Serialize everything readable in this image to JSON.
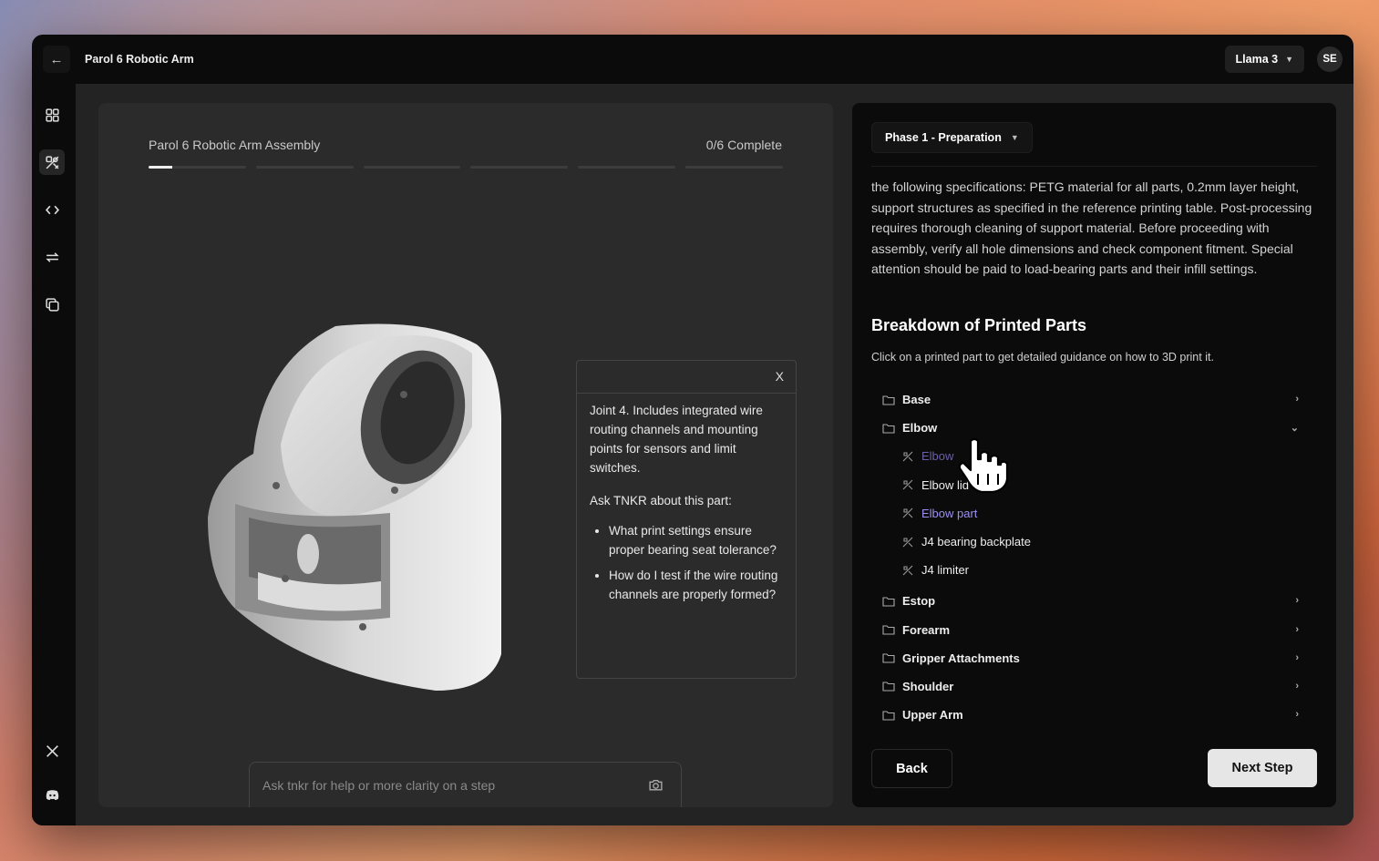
{
  "titlebar": {
    "back_icon": "←",
    "app_title": "Parol 6 Robotic Arm",
    "model": "Llama 3",
    "avatar_initials": "SE"
  },
  "sidebar": {
    "items": [
      {
        "icon": "grid-icon"
      },
      {
        "icon": "tools-icon",
        "active": true
      },
      {
        "icon": "code-icon"
      },
      {
        "icon": "repeat-icon"
      },
      {
        "icon": "copy-icon"
      },
      {
        "icon": "x-logo-icon"
      },
      {
        "icon": "discord-icon"
      }
    ]
  },
  "assembly": {
    "title": "Parol 6 Robotic Arm Assembly",
    "status": "0/6 Complete",
    "progress": {
      "total_steps": 6,
      "completed": 0
    }
  },
  "info_card": {
    "close_label": "X",
    "description": "Joint 4. Includes integrated wire routing channels and mounting points for sensors and limit switches.",
    "ask_heading": "Ask TNKR about this part:",
    "questions": [
      "What print settings ensure proper bearing seat tolerance?",
      "How do I test if the wire routing channels are properly formed?"
    ]
  },
  "chat": {
    "placeholder": "Ask tnkr for help or more clarity on a step"
  },
  "guide": {
    "phase": "Phase 1 - Preparation",
    "spec_text": "the following specifications: PETG material for all parts, 0.2mm layer height, support structures as specified in the reference printing table. Post-processing requires thorough cleaning of support material. Before proceeding with assembly, verify all hole dimensions and check component fitment. Special attention should be paid to load-bearing parts and their infill settings.",
    "breakdown_title": "Breakdown of Printed Parts",
    "breakdown_desc": "Click on a printed part to get detailed guidance on how to 3D print it.",
    "folders": {
      "base": "Base",
      "elbow": "Elbow",
      "estop": "Estop",
      "forearm": "Forearm",
      "gripper": "Gripper Attachments",
      "shoulder": "Shoulder",
      "upper_arm": "Upper Arm"
    },
    "elbow_parts": [
      "Elbow",
      "Elbow lid",
      "Elbow part",
      "J4 bearing backplate",
      "J4 limiter"
    ],
    "back_label": "Back",
    "next_label": "Next Step"
  },
  "colors": {
    "accent_part": "#9c8ff0",
    "panel_dark": "#0b0b0b",
    "panel_gray": "#2b2b2b"
  }
}
